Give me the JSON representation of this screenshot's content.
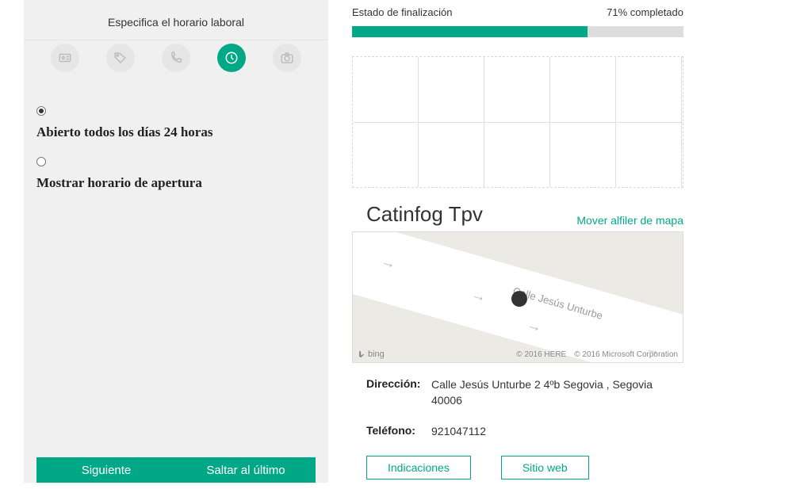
{
  "left": {
    "title": "Especifica el horario laboral",
    "steps": [
      "id-card-icon",
      "tag-icon",
      "phone-icon",
      "clock-icon",
      "camera-icon"
    ],
    "options": {
      "open_always": "Abierto todos los días 24 horas",
      "show_hours": "Mostrar horario de apertura"
    },
    "footer": {
      "next": "Siguiente",
      "skip": "Saltar al último"
    }
  },
  "right": {
    "status_label": "Estado de finalización",
    "status_value": "71% completado",
    "progress_pct": 71,
    "business_name": "Catinfog Tpv",
    "move_pin": "Mover alfiler de mapa",
    "map": {
      "street": "Calle Jesús Unturbe",
      "logo": "bing",
      "attr_here": "© 2016 HERE",
      "attr_ms": "© 2016 Microsoft Corporation"
    },
    "address_label": "Dirección:",
    "address_value": "Calle Jesús Unturbe 2 4ºb Segovia ,  Segovia 40006",
    "phone_label": "Teléfono:",
    "phone_value": "921047112",
    "btn_directions": "Indicaciones",
    "btn_website": "Sitio web"
  }
}
